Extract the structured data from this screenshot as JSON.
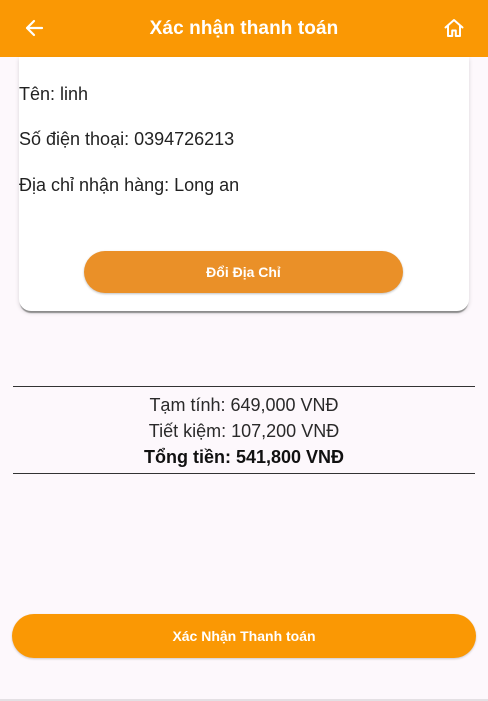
{
  "colors": {
    "brand": "#fa9804",
    "button_secondary": "#ea9028",
    "background": "#fdf8fc"
  },
  "app_bar": {
    "title": "Xác nhận thanh toán",
    "back_icon": "arrow-left-icon",
    "home_icon": "home-icon"
  },
  "customer": {
    "name_line": "Tên: linh",
    "phone_line": "Số điện thoại: 0394726213",
    "address_line": "Địa chỉ nhận hàng: Long an",
    "change_address_label": "Đổi Địa Chỉ"
  },
  "summary": {
    "subtotal_line": "Tạm tính: 649,000 VNĐ",
    "savings_line": "Tiết kiệm: 107,200 VNĐ",
    "total_line": "Tổng tiền: 541,800 VNĐ"
  },
  "confirm_label": "Xác Nhận Thanh toán"
}
